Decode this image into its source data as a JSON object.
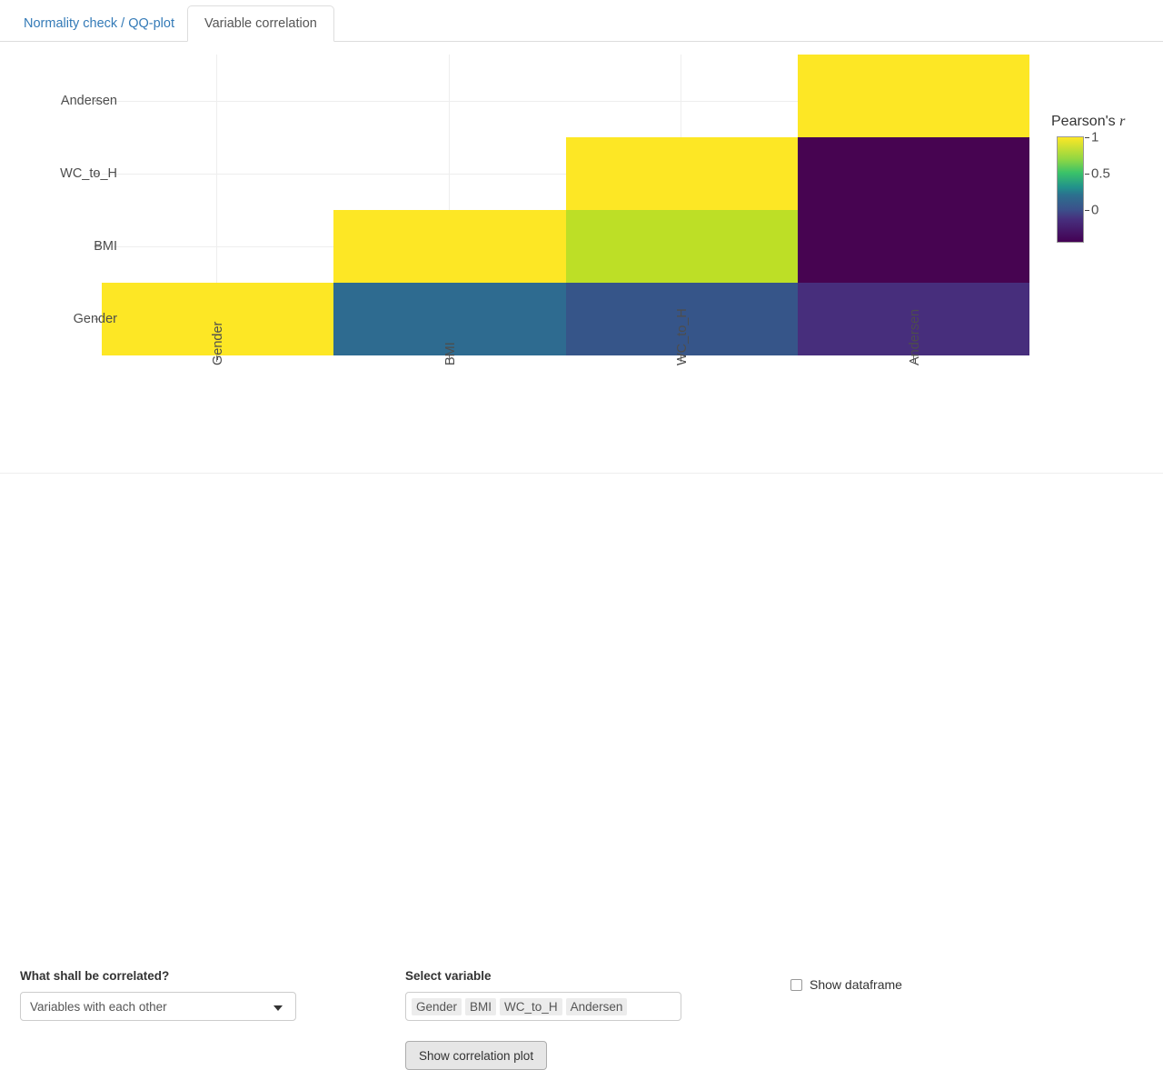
{
  "tabs": [
    {
      "label": "Normality check / QQ-plot",
      "active": false
    },
    {
      "label": "Variable correlation",
      "active": true
    }
  ],
  "chart_data": {
    "type": "heatmap",
    "title": "",
    "legend_title": "Pearson's r",
    "legend_position": "right",
    "grid": true,
    "xlabel": "",
    "ylabel": "",
    "x_categories": [
      "Gender",
      "BMI",
      "WC_to_H",
      "Andersen"
    ],
    "y_categories": [
      "Gender",
      "BMI",
      "WC_to_H",
      "Andersen"
    ],
    "y_display_order": [
      "Andersen",
      "WC_to_H",
      "BMI",
      "Gender"
    ],
    "colorscale": "viridis",
    "zlim": [
      -0.45,
      1
    ],
    "colorbar_ticks": [
      1,
      0.5,
      0
    ],
    "colorbar_tick_labels": [
      "1",
      "0.5",
      "0"
    ],
    "note": "lower-triangular matrix; upper triangle blank",
    "matrix": [
      {
        "row": "Gender",
        "col": "Gender",
        "value": 1.0,
        "color": "#fde725"
      },
      {
        "row": "Gender",
        "col": "BMI",
        "value": 0.3,
        "color": "#2e6b90"
      },
      {
        "row": "Gender",
        "col": "WC_to_H",
        "value": 0.22,
        "color": "#365589"
      },
      {
        "row": "Gender",
        "col": "Andersen",
        "value": 0.05,
        "color": "#472e7c"
      },
      {
        "row": "BMI",
        "col": "BMI",
        "value": 1.0,
        "color": "#fde725"
      },
      {
        "row": "BMI",
        "col": "WC_to_H",
        "value": 0.86,
        "color": "#bddf26"
      },
      {
        "row": "BMI",
        "col": "Andersen",
        "value": -0.4,
        "color": "#470451"
      },
      {
        "row": "WC_to_H",
        "col": "WC_to_H",
        "value": 1.0,
        "color": "#fde725"
      },
      {
        "row": "WC_to_H",
        "col": "Andersen",
        "value": -0.4,
        "color": "#470451"
      },
      {
        "row": "Andersen",
        "col": "Andersen",
        "value": 1.0,
        "color": "#fde725"
      }
    ]
  },
  "controls": {
    "correlated_label": "What shall be correlated?",
    "correlated_value": "Variables with each other",
    "variable_label": "Select variable",
    "variable_chips": [
      "Gender",
      "BMI",
      "WC_to_H",
      "Andersen"
    ],
    "show_plot_button": "Show correlation plot",
    "show_dataframe_label": "Show dataframe",
    "show_dataframe_checked": false
  }
}
